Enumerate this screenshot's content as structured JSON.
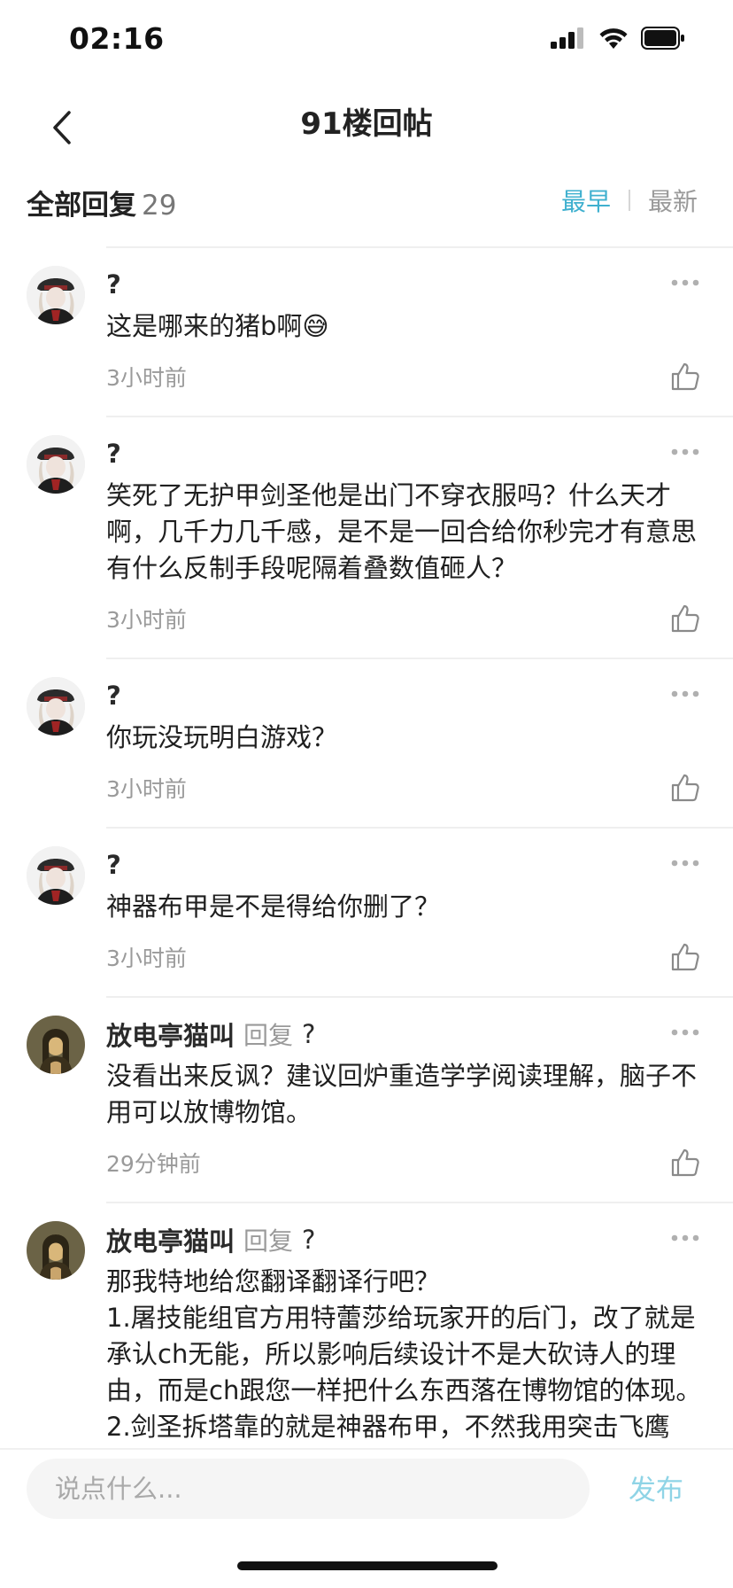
{
  "status_bar": {
    "time": "02:16"
  },
  "nav": {
    "title": "91楼回帖"
  },
  "reply_header": {
    "label": "全部回复",
    "count": "29",
    "sort_earliest": "最早",
    "sort_latest": "最新"
  },
  "colors": {
    "accent": "#3fb0cf",
    "publish_disabled": "#8fd4e6",
    "muted": "#9a9a9a"
  },
  "comments": [
    {
      "author": "?",
      "reply_word": "",
      "reply_to": "",
      "text": "这是哪来的猪b啊😅",
      "time": "3小时前",
      "avatar": "anime-avatar"
    },
    {
      "author": "?",
      "reply_word": "",
      "reply_to": "",
      "text": "笑死了无护甲剑圣他是出门不穿衣服吗？什么天才啊，几千力几千感，是不是一回合给你秒完才有意思有什么反制手段呢隔着叠数值砸人？",
      "time": "3小时前",
      "avatar": "anime-avatar"
    },
    {
      "author": "?",
      "reply_word": "",
      "reply_to": "",
      "text": "你玩没玩明白游戏？",
      "time": "3小时前",
      "avatar": "anime-avatar"
    },
    {
      "author": "?",
      "reply_word": "",
      "reply_to": "",
      "text": "神器布甲是不是得给你删了？",
      "time": "3小时前",
      "avatar": "anime-avatar"
    },
    {
      "author": "放电亭猫叫",
      "reply_word": "回复",
      "reply_to": "?",
      "text": "没看出来反讽？建议回炉重造学学阅读理解，脑子不用可以放博物馆。",
      "time": "29分钟前",
      "avatar": "mona-lisa-avatar"
    },
    {
      "author": "放电亭猫叫",
      "reply_word": "回复",
      "reply_to": "?",
      "text": "那我特地给您翻译翻译行吧？\n1.屠技能组官方用特蕾莎给玩家开的后门，改了就是承认ch无能，所以影响后续设计不是大砍诗人的理由，而是ch跟您一样把什么东西落在博物馆的体现。\n2.剑圣拆塔靠的就是神器布甲，不然我用突击飞鹰",
      "time": "",
      "avatar": "mona-lisa-avatar"
    }
  ],
  "input": {
    "placeholder": "说点什么...",
    "publish_label": "发布"
  }
}
